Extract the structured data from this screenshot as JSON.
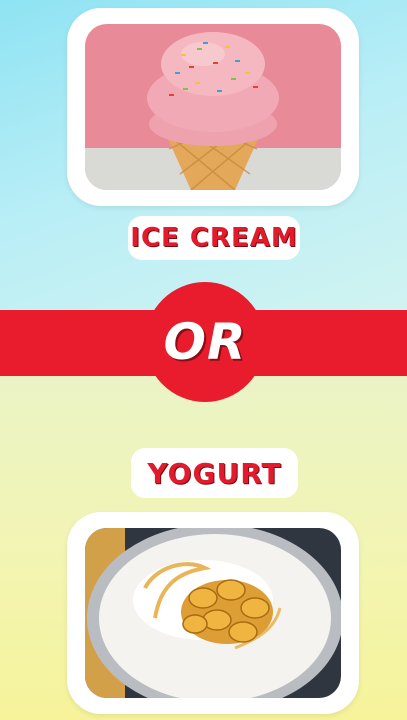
{
  "options": {
    "first": {
      "label": "ICE CREAM",
      "image_subject": "ice-cream-cone"
    },
    "second": {
      "label": "YOGURT",
      "image_subject": "yogurt-with-honey"
    }
  },
  "divider": {
    "text": "OR"
  },
  "colors": {
    "accent_red": "#e81c2d",
    "label_red": "#e21b2c",
    "top_background": "#b9eef6",
    "bottom_background": "#f3f5b0"
  }
}
